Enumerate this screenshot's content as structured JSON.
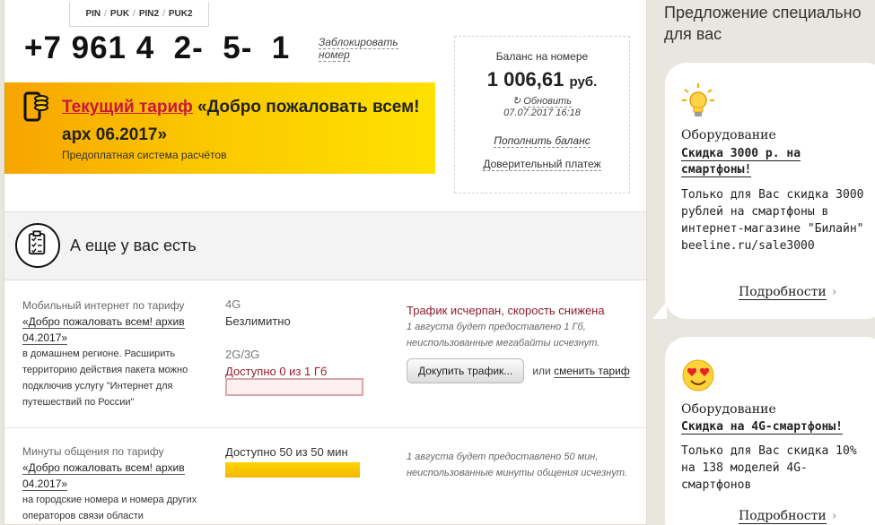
{
  "pin_tabs": [
    "PIN",
    "PUK",
    "PIN2",
    "PUK2"
  ],
  "phone": "+7 961 4  2-  5-  1",
  "block_number": "Заблокировать номер",
  "tariff": {
    "link": "Текущий тариф",
    "name": "«Добро пожаловать всем! арх 06.2017»",
    "subtitle": "Предоплатная система расчётов"
  },
  "balance": {
    "label": "Баланс на номере",
    "amount": "1 006,61",
    "currency": "руб.",
    "refresh": "Обновить",
    "date": "07.07.2017 16:18",
    "topup": "Пополнить баланс",
    "trust_payment": "Доверительный платеж"
  },
  "also": {
    "title": "А еще у вас есть"
  },
  "services": [
    {
      "label": "Мобильный интернет по тарифу",
      "tariff_link": "«Добро пожаловать всем! архив 04.2017»",
      "desc": "в домашнем регионе. Расширить территорию действия пакета можно подключив услугу \"Интернет для путешествий по России\"",
      "type1": "4G",
      "value1": "Безлимитно",
      "type2": "2G/3G",
      "available": "Доступно 0 из 1 Гб",
      "available_fraction": 0,
      "warning": "Трафик исчерпан, скорость снижена",
      "note": "1 августа будет предоставлено 1 Гб, неиспользованные мегабайты исчезнут.",
      "buy_button": "Докупить трафик...",
      "or_text": "или",
      "change_tariff": "сменить тариф"
    },
    {
      "label": "Минуты общения по тарифу",
      "tariff_link": "«Добро пожаловать всем! архив 04.2017»",
      "desc": "на городские номера и номера других операторов связи области",
      "available": "Доступно 50 из 50 мин",
      "available_fraction": 1,
      "note": "1 августа будет предоставлено 50 мин, неиспользованные минуты общения исчезнут."
    }
  ],
  "sidebar": {
    "title": "Предложение специально для вас",
    "cards": [
      {
        "icon": "lightbulb-icon",
        "category": "Оборудование",
        "link": "Скидка 3000 р. на смартфоны!",
        "text": "Только для Вас скидка 3000 рублей на смартфоны в интернет-магазине \"Билайн\" beeline.ru/sale3000",
        "more": "Подробности"
      },
      {
        "icon": "heart-eyes-emoji-icon",
        "category": "Оборудование",
        "link": "Скидка на 4G-смартфоны!",
        "text": "Только для Вас скидка 10% на 138 моделей 4G-смартфонов",
        "more": "Подробности"
      }
    ]
  },
  "colors": {
    "accent": "#ffd500",
    "link_red": "#c8163f",
    "warning": "#8d1c2c"
  }
}
